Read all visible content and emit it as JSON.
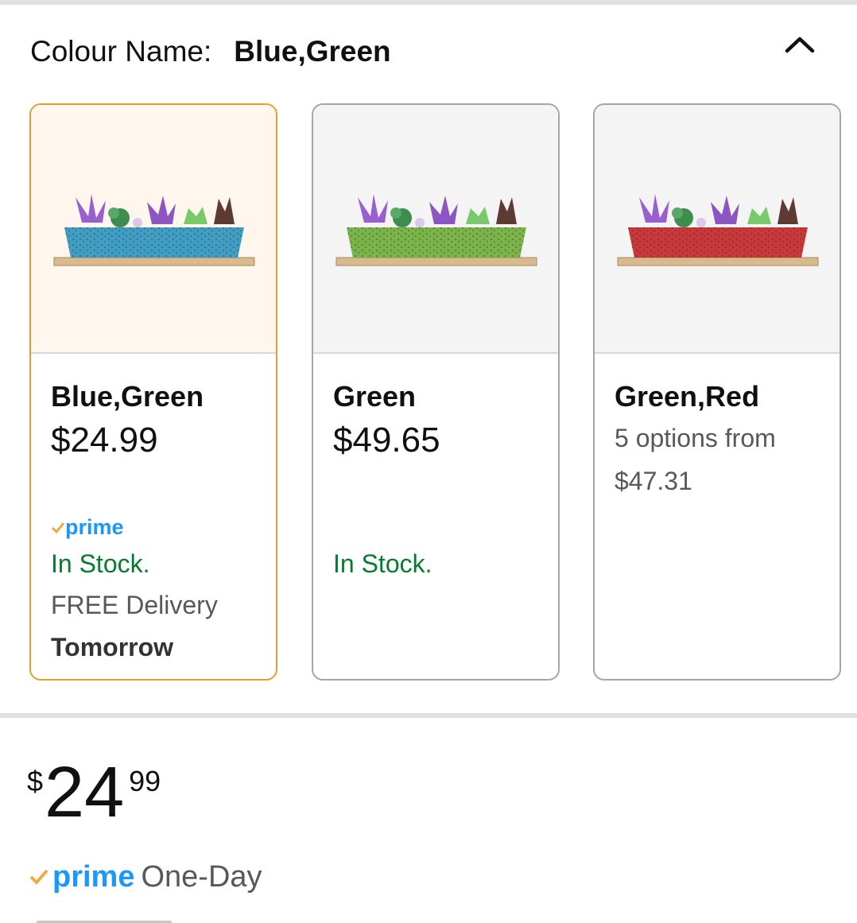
{
  "colour": {
    "label": "Colour Name:",
    "value": "Blue,Green"
  },
  "icons": {
    "collapse": "chevron-up-icon",
    "prime_check": "check-icon"
  },
  "colors": {
    "accent_selected": "#e3a02e",
    "in_stock": "#067d2e",
    "prime": "#1a98ff",
    "prime_check": "#f3a847"
  },
  "variants": [
    {
      "name": "Blue,Green",
      "price": "$24.99",
      "selected": true,
      "planter_color": "#3e9fc6",
      "prime": "prime",
      "stock": "In Stock.",
      "delivery": "FREE Delivery",
      "delivery_day": "Tomorrow"
    },
    {
      "name": "Green",
      "price": "$49.65",
      "selected": false,
      "planter_color": "#79b54a",
      "stock": "In Stock."
    },
    {
      "name": "Green,Red",
      "options_text": "5 options from",
      "options_price": "$47.31",
      "selected": false,
      "planter_color": "#c9383a"
    }
  ],
  "price": {
    "currency": "$",
    "whole": "24",
    "fraction": "99"
  },
  "delivery_badge": {
    "prime": "prime",
    "text": "One-Day"
  }
}
